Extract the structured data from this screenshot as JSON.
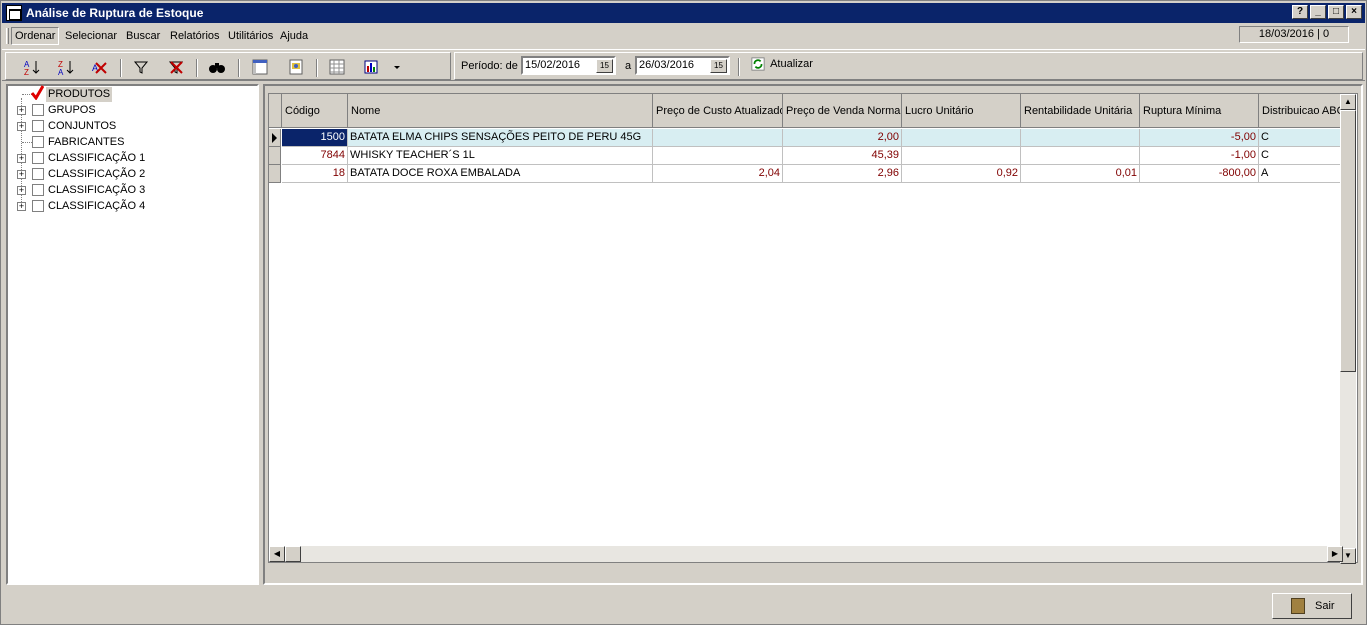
{
  "window": {
    "title": "Análise de Ruptura de Estoque",
    "controls": [
      "?",
      "_",
      "□",
      "×"
    ]
  },
  "menu": {
    "items": [
      "Ordenar",
      "Selecionar",
      "Buscar",
      "Relatórios",
      "Utilitários",
      "Ajuda"
    ],
    "date_status": "18/03/2016 | 0"
  },
  "toolbar": {
    "period_label": "Período: de",
    "to_label": "a",
    "date_from": "15/02/2016",
    "date_to": "26/03/2016",
    "calendar_glyph": "15",
    "refresh_label": "Atualizar"
  },
  "tree": {
    "nodes": [
      {
        "label": "PRODUTOS",
        "checked": true,
        "expandable": false
      },
      {
        "label": "GRUPOS",
        "checked": false,
        "expandable": true
      },
      {
        "label": "CONJUNTOS",
        "checked": false,
        "expandable": true
      },
      {
        "label": "FABRICANTES",
        "checked": false,
        "expandable": false
      },
      {
        "label": "CLASSIFICAÇÃO 1",
        "checked": false,
        "expandable": true
      },
      {
        "label": "CLASSIFICAÇÃO 2",
        "checked": false,
        "expandable": true
      },
      {
        "label": "CLASSIFICAÇÃO 3",
        "checked": false,
        "expandable": true
      },
      {
        "label": "CLASSIFICAÇÃO 4",
        "checked": false,
        "expandable": true
      }
    ]
  },
  "grid": {
    "columns": [
      "Código",
      "Nome",
      "Preço de Custo Atualizado",
      "Preço de Venda Normal",
      "Lucro Unitário",
      "Rentabilidade Unitária",
      "Ruptura Mínima",
      "Distribuicao ABC"
    ],
    "rows": [
      [
        "1500",
        "BATATA ELMA CHIPS SENSAÇÕES PEITO DE PERU 45G",
        "",
        "2,00",
        "",
        "",
        "-5,00",
        "C"
      ],
      [
        "7844",
        "WHISKY TEACHER´S 1L",
        "",
        "45,39",
        "",
        "",
        "-1,00",
        "C"
      ],
      [
        "18",
        "BATATA DOCE ROXA EMBALADA",
        "2,04",
        "2,96",
        "0,92",
        "0,01",
        "-800,00",
        "A"
      ]
    ]
  },
  "footer": {
    "exit_label": "Sair"
  },
  "colors": {
    "title_bar": "#0a246a",
    "selected_row": "#d8eef2",
    "number_text": "#800000"
  }
}
